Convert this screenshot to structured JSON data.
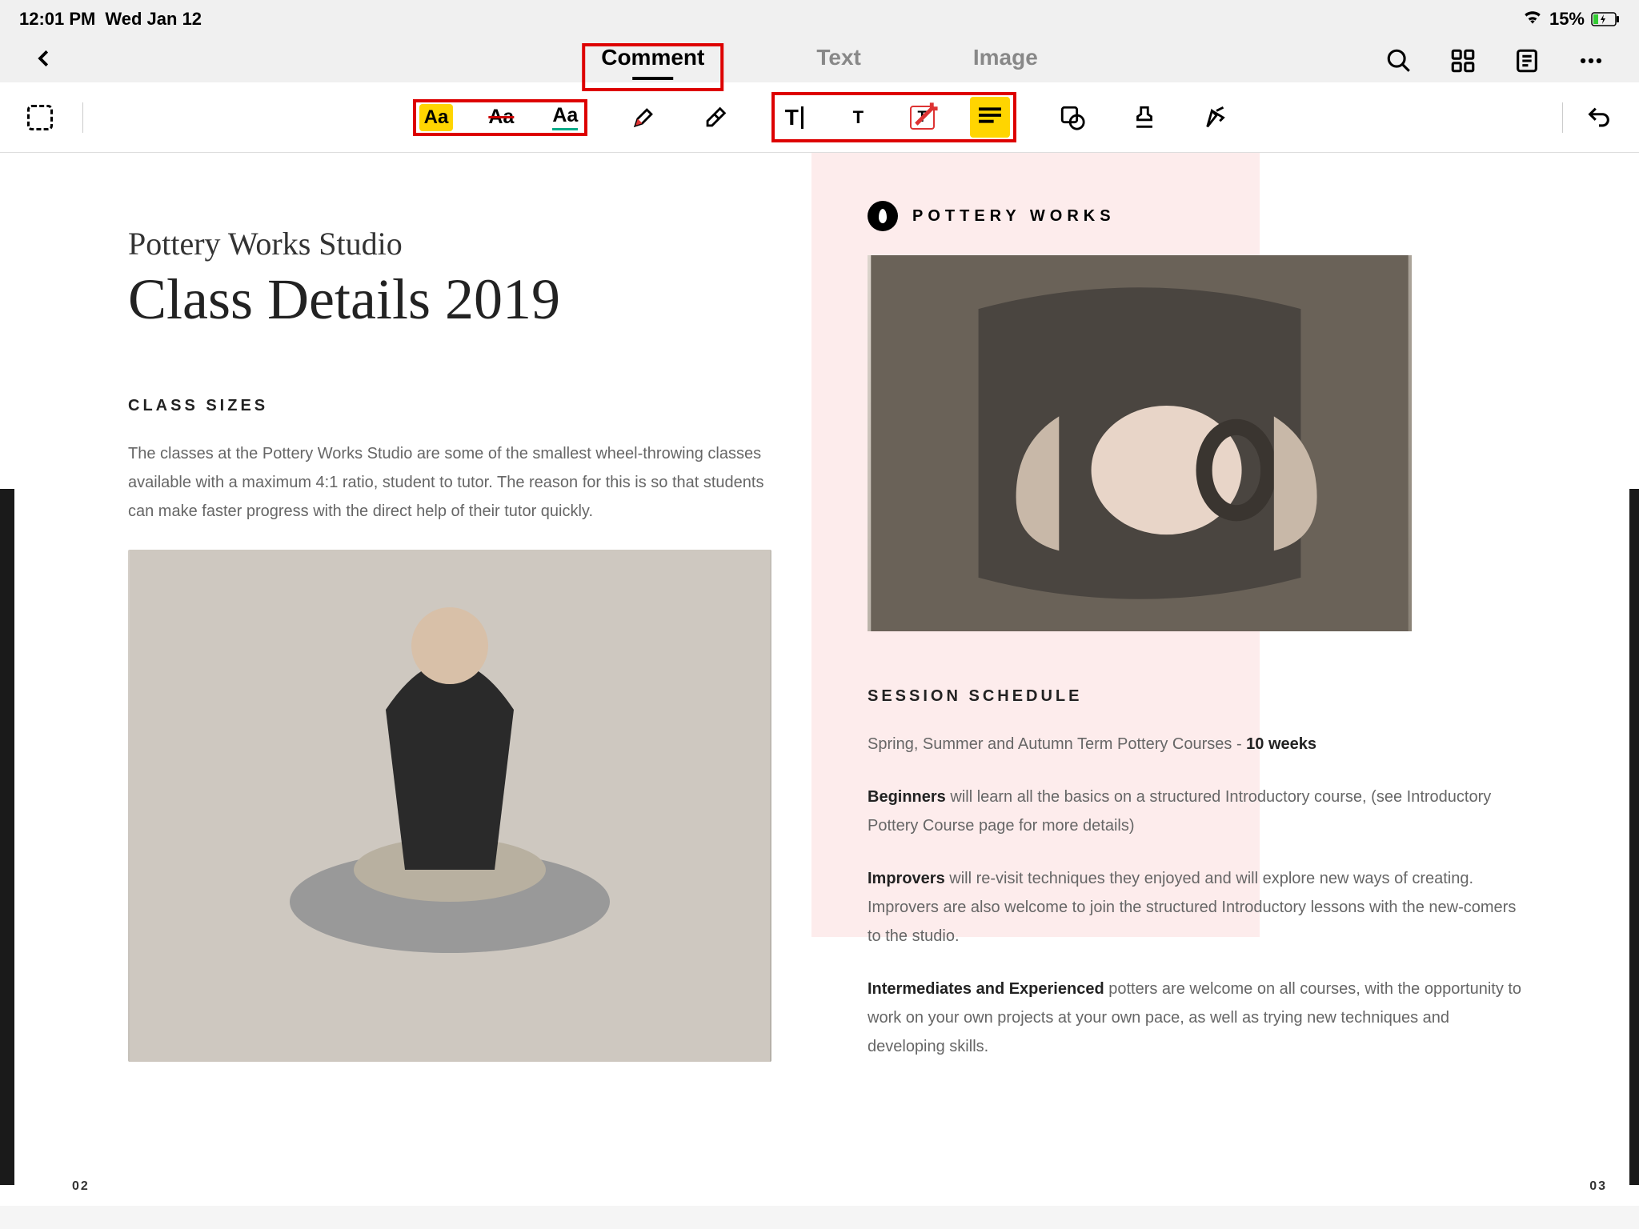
{
  "status": {
    "time": "12:01 PM",
    "date": "Wed Jan 12",
    "battery": "15%"
  },
  "tabs": {
    "comment": "Comment",
    "text": "Text",
    "image": "Image"
  },
  "tools": {
    "highlight": "Aa",
    "strike": "Aa",
    "underline": "Aa",
    "text_cursor": "T",
    "text_small": "T",
    "text_box": "T"
  },
  "doc": {
    "subtitle": "Pottery Works Studio",
    "title": "Class Details 2019",
    "section1_hdr": "CLASS SIZES",
    "section1_body": "The classes at the Pottery Works Studio are some of the smallest wheel-throwing classes available with a maximum 4:1 ratio, student to tutor. The reason for this is so that students can make faster progress with the direct help of their tutor quickly.",
    "brand": "POTTERY WORKS",
    "section2_hdr": "SESSION SCHEDULE",
    "schedule_intro": "Spring, Summer and Autumn Term Pottery Courses - ",
    "schedule_weeks": "10 weeks",
    "beginners_lbl": "Beginners",
    "beginners_txt": " will learn all the basics on a structured Introductory course, (see Introductory Pottery Course page for more details)",
    "improvers_lbl": "Improvers",
    "improvers_txt": " will re-visit techniques they enjoyed and will explore new ways of creating. Improvers are also welcome to join the structured Introductory lessons with the new-comers to the studio.",
    "inter_lbl": "Intermediates and Experienced",
    "inter_txt": " potters are welcome on all courses, with the opportunity to work on your own projects at your own pace, as well as trying new techniques and developing skills.",
    "page_left": "02",
    "page_right": "03"
  }
}
